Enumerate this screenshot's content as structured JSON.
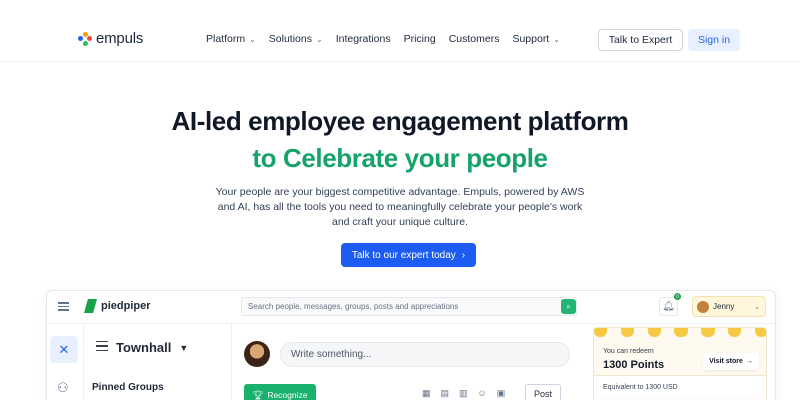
{
  "nav": {
    "logo_text": "empuls",
    "menu": [
      {
        "label": "Platform",
        "has_dropdown": true
      },
      {
        "label": "Solutions",
        "has_dropdown": true
      },
      {
        "label": "Integrations",
        "has_dropdown": false
      },
      {
        "label": "Pricing",
        "has_dropdown": false
      },
      {
        "label": "Customers",
        "has_dropdown": false
      },
      {
        "label": "Support",
        "has_dropdown": true
      }
    ],
    "talk_button": "Talk to Expert",
    "signin_button": "Sign in"
  },
  "hero": {
    "title_line1": "AI-led employee engagement platform",
    "title_line2": "to Celebrate your people",
    "description": "Your people are your biggest competitive advantage. Empuls, powered by AWS and AI, has all the tools you need to meaningfully celebrate your people's work and craft your unique culture.",
    "cta_label": "Talk to our expert today",
    "cta_arrow": "›"
  },
  "app_mock": {
    "brand": "piedpiper",
    "search_placeholder": "Search people, messages, groups, posts and appreciations",
    "notification_count": "0",
    "user_name": "Jenny",
    "panel_title": "Townhall",
    "pinned_heading": "Pinned Groups",
    "composer_placeholder": "Write something...",
    "recognize_label": "Recognize",
    "post_label": "Post",
    "redeem_label": "You can redeem",
    "points_value": "1300 Points",
    "visit_store_label": "Visit store",
    "equivalent_label": "Equivalent to 1300 USD"
  },
  "colors": {
    "accent_green": "#16a36a",
    "cta_blue": "#1d5cf0",
    "signin_bg": "#e8efff"
  }
}
